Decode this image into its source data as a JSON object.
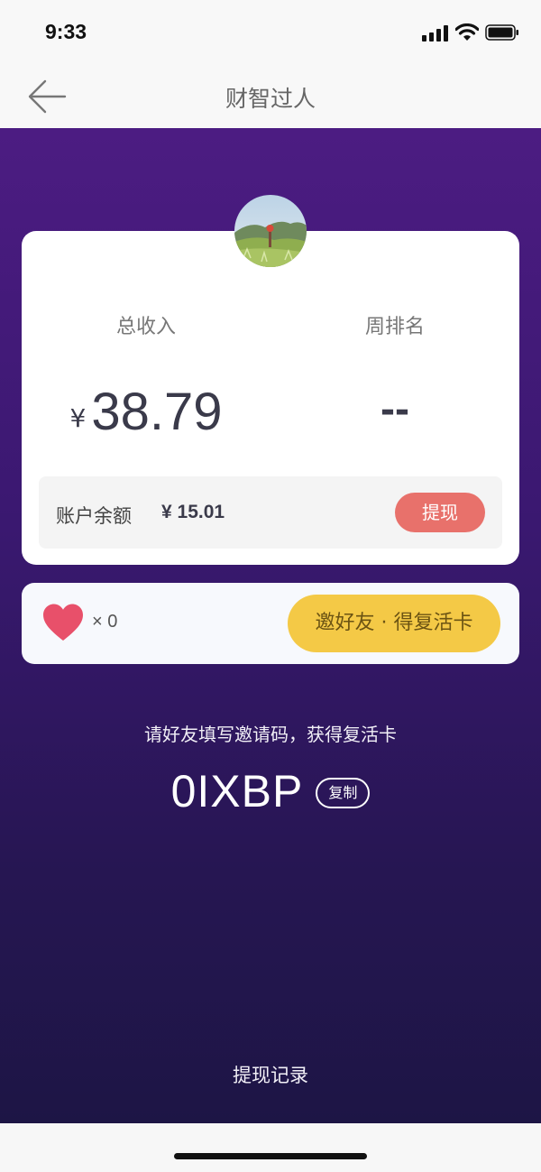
{
  "status_bar": {
    "time": "9:33"
  },
  "nav": {
    "title": "财智过人"
  },
  "stats": {
    "total_income_label": "总收入",
    "currency_symbol": "¥",
    "total_income_value": "38.79",
    "weekly_rank_label": "周排名",
    "weekly_rank_value": "--"
  },
  "balance": {
    "label": "账户余额",
    "value": "¥ 15.01",
    "withdraw_label": "提现"
  },
  "lives": {
    "count_text": "× 0",
    "invite_button_label": "邀好友 · 得复活卡"
  },
  "invite": {
    "hint": "请好友填写邀请码，获得复活卡",
    "code": "0IXBP",
    "copy_label": "复制"
  },
  "footer": {
    "withdraw_record_label": "提现记录"
  },
  "colors": {
    "purple_top": "#4c1c82",
    "purple_bottom": "#1d1545",
    "withdraw_button": "#e8716b",
    "invite_button": "#f4c946",
    "heart": "#e8506a"
  }
}
